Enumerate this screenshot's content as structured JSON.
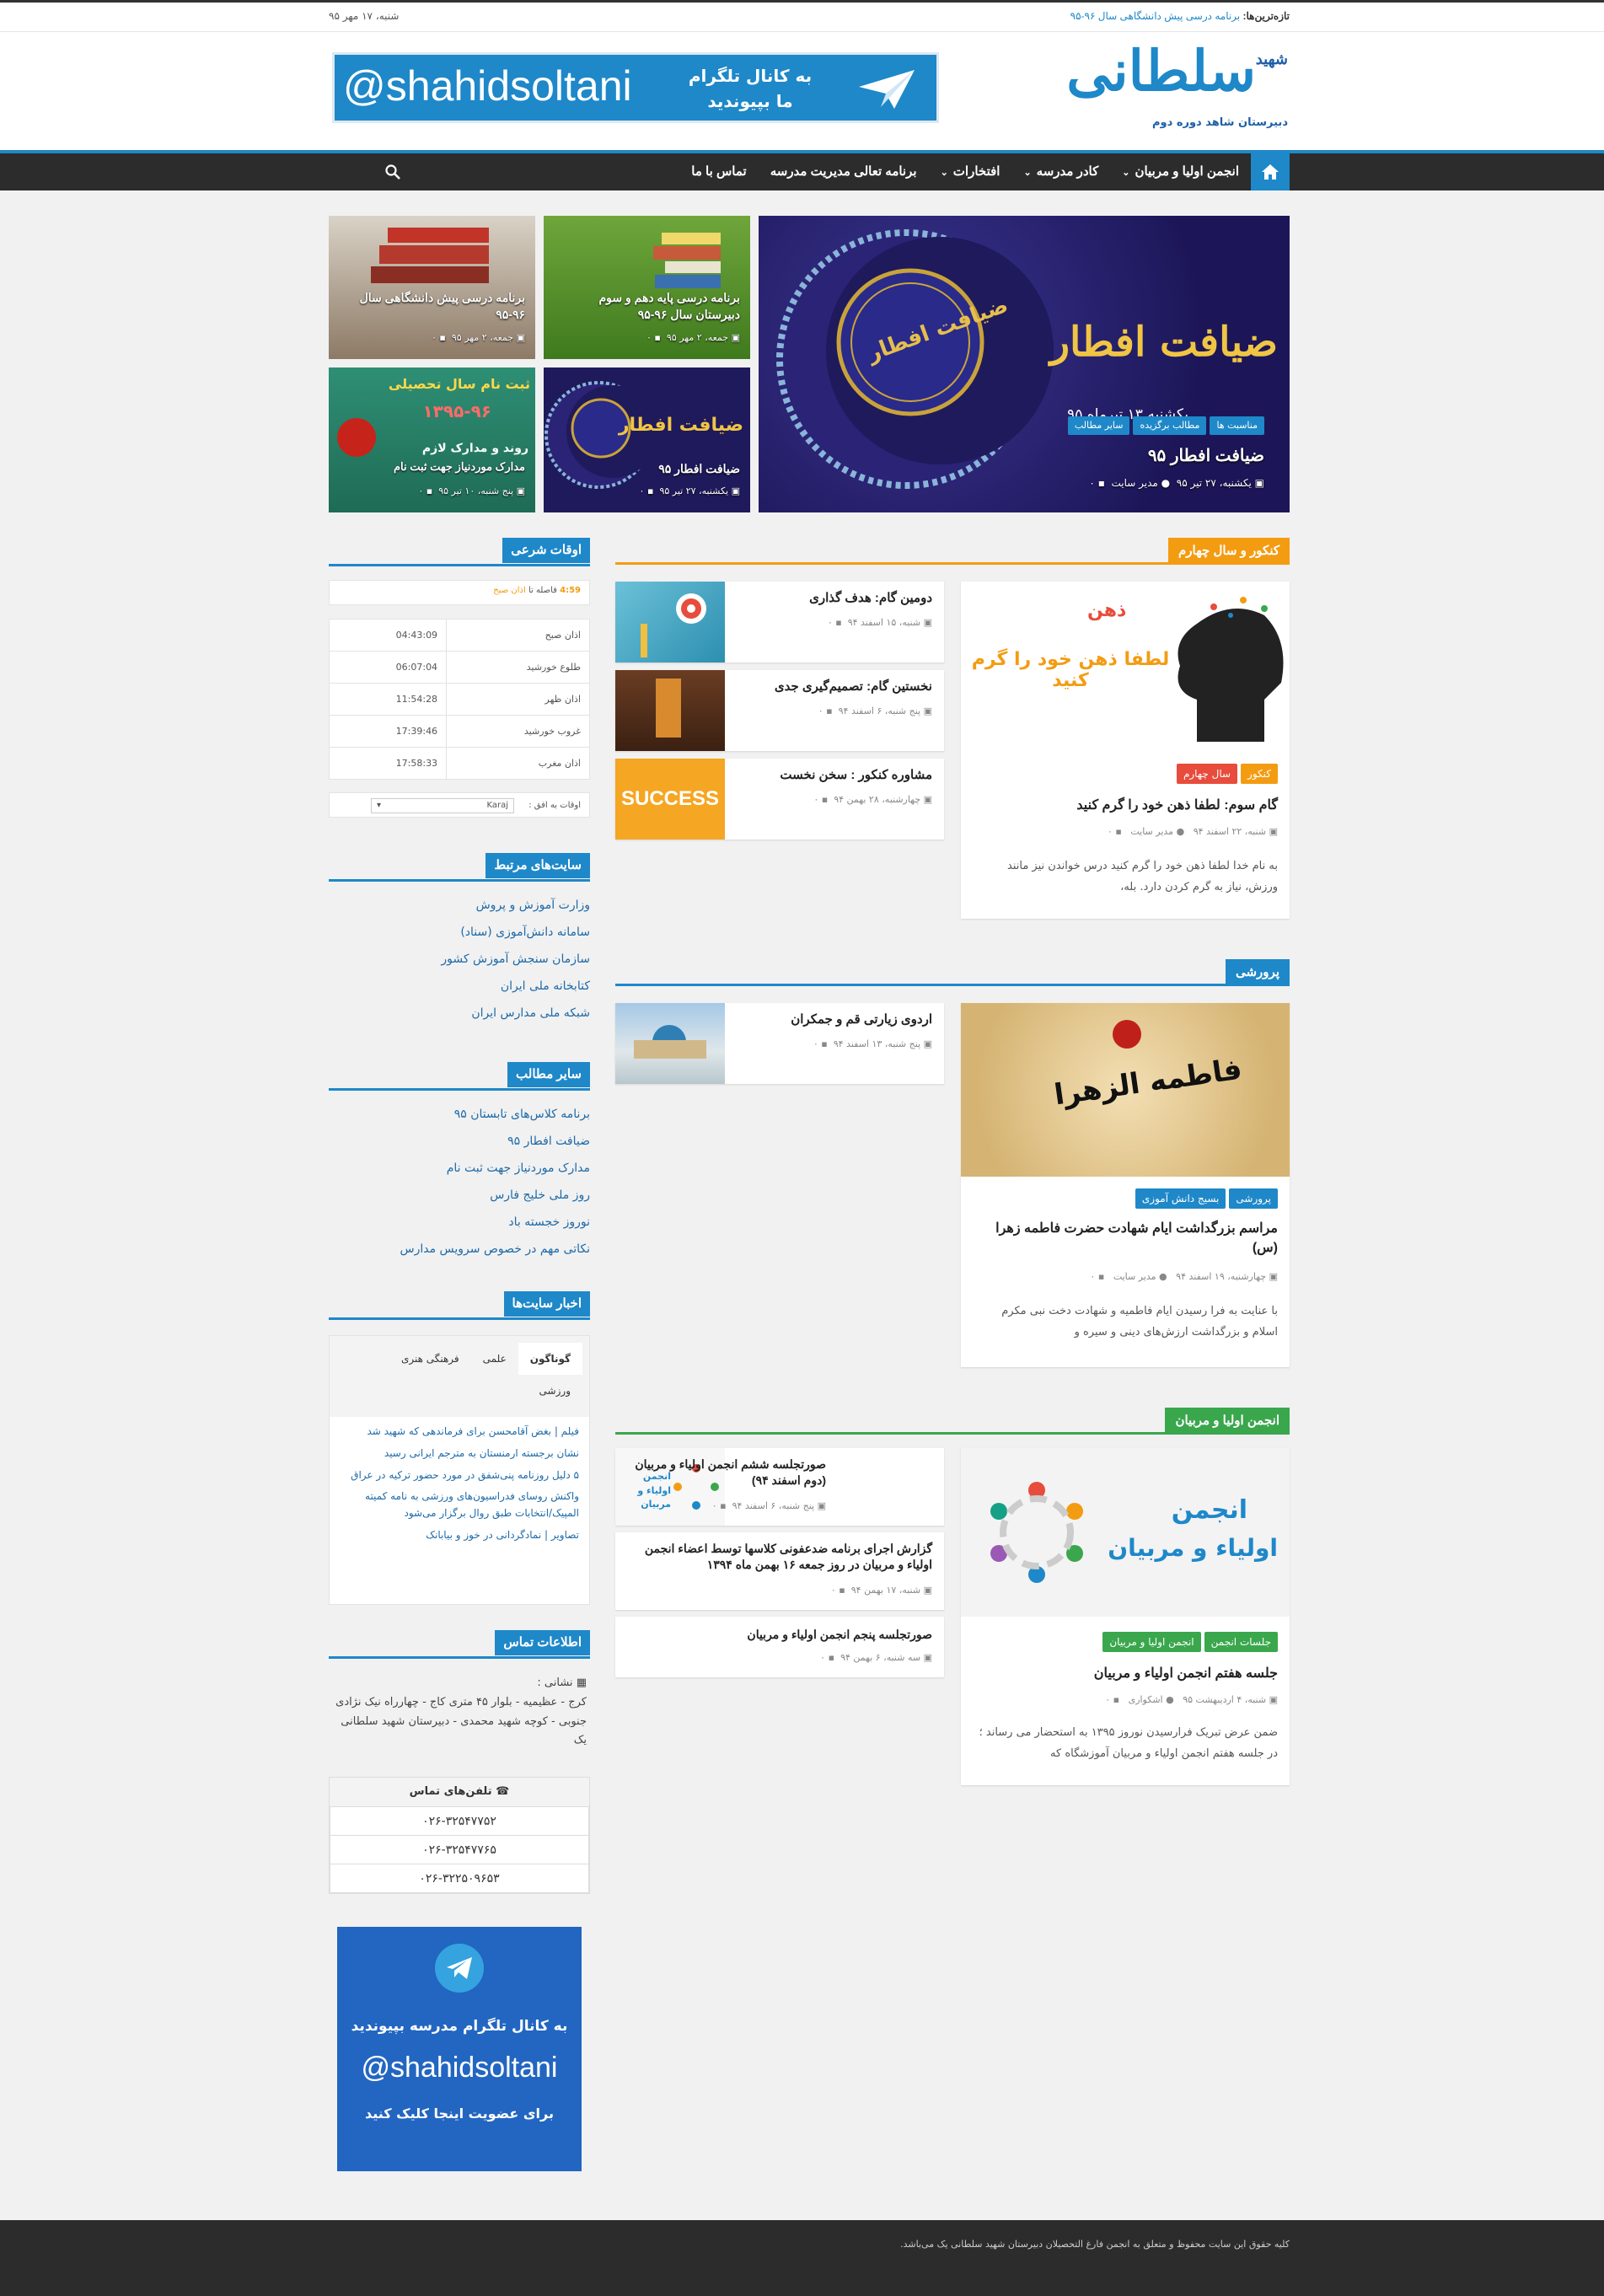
{
  "topbar": {
    "latest_label": "تازه‌ترین‌ها:",
    "latest_post": "برنامه درسی پیش دانشگاهی سال ۹۶-۹۵",
    "date": "شنبه، ۱۷ مهر ۹۵"
  },
  "header": {
    "logo_text": "سلطانی",
    "logo_small": "شهید",
    "logo_sub": "دبیرستان شاهد دوره دوم",
    "banner_handle": "@shahidsoltani",
    "banner_text": "به کانال تلگرام ما بپیوندید"
  },
  "nav": {
    "items": [
      {
        "label": "انجمن اولیا و مربیان",
        "has_sub": true
      },
      {
        "label": "کادر مدرسه",
        "has_sub": true
      },
      {
        "label": "افتخارات",
        "has_sub": true
      },
      {
        "label": "برنامه تعالی مدیریت مدرسه",
        "has_sub": false
      },
      {
        "label": "تماس با ما",
        "has_sub": false
      }
    ]
  },
  "slider": {
    "big": {
      "title": "ضیافت افطار ۹۵",
      "date": "یکشنبه، ۲۷ تیر ۹۵",
      "author": "مدیر سایت",
      "comments": "۰",
      "image_text": "ضیافت افطار",
      "image_overlay_date": "یکشنبه ۱۳ تیرماه ۹۵",
      "tags": [
        "سایر مطالب",
        "مطالب برگزیده",
        "مناسبت ها"
      ]
    },
    "tiles": [
      {
        "title": "برنامه درسی پایه دهم و سوم دبیرستان سال ۹۶-۹۵",
        "date": "جمعه، ۲ مهر ۹۵",
        "comments": "۰"
      },
      {
        "title": "برنامه درسی پیش دانشگاهی سال ۹۶-۹۵",
        "date": "جمعه، ۲ مهر ۹۵",
        "comments": "۰"
      },
      {
        "title": "ضیافت افطار ۹۵",
        "date": "یکشنبه، ۲۷ تیر ۹۵",
        "comments": "۰",
        "image_text": "ضیافت افطار"
      },
      {
        "title": "مدارک موردنیاز جهت ثبت نام",
        "date": "پنج شنبه، ۱۰ تیر ۹۵",
        "comments": "۰",
        "image_text": "ثبت نام سال تحصیلی",
        "image_text2": "۱۳۹۵-۹۶",
        "image_text3": "روند و مدارک لازم"
      }
    ]
  },
  "sections": [
    {
      "label": "کنکور و سال چهارم",
      "color": "#f39c12",
      "main": {
        "title": "گام سوم: لطفا ذهن خود را گرم کنید",
        "date": "شنبه، ۲۲ اسفند ۹۴",
        "author": "مدیر سایت",
        "comments": "۰",
        "excerpt": "به نام خدا لطفا ذهن خود را گرم کنید درس خواندن نیز مانند ورزش، نیاز به گرم کردن دارد. بله،",
        "tags": [
          "سال چهارم",
          "کنکور"
        ],
        "image_text": "لطفا ذهن خود را گرم کنید",
        "image_word": "ذهن"
      },
      "side": [
        {
          "title": "دومین گام: هدف گذاری",
          "date": "شنبه، ۱۵ اسفند ۹۴",
          "comments": "۰"
        },
        {
          "title": "نخستین گام: تصمیم‌گیری جدی",
          "date": "پنج شنبه، ۶ اسفند ۹۴",
          "comments": "۰"
        },
        {
          "title": "مشاوره کنکور : سخن نخست",
          "date": "چهارشنبه، ۲۸ بهمن ۹۴",
          "comments": "۰",
          "image_text": "SUCCESS"
        }
      ]
    },
    {
      "label": "پرورشی",
      "color": "#1e88c9",
      "main": {
        "title": "مراسم بزرگداشت ایام شهادت حضرت فاطمه زهرا (س)",
        "date": "چهارشنبه، ۱۹ اسفند ۹۴",
        "author": "مدیر سایت",
        "comments": "۰",
        "excerpt": "با عنایت به فرا رسیدن ایام فاطمیه و شهادت دخت نبی مکرم اسلام و بزرگداشت ارزش‌های دینی و سیره و",
        "tags": [
          "بسیج دانش آموزی",
          "پرورشی"
        ],
        "image_text": "فاطمه الزهرا"
      },
      "side": [
        {
          "title": "اردوی زیارتی قم و جمکران",
          "date": "پنج شنبه، ۱۳ اسفند ۹۴",
          "comments": "۰"
        }
      ]
    },
    {
      "label": "انجمن اولیا و مربیان",
      "color": "#3aa74d",
      "main": {
        "title": "جلسه هفتم انجمن اولیاء و مربیان",
        "date": "شنبه، ۴ اردیبهشت ۹۵",
        "author": "اشکواری",
        "comments": "۰",
        "excerpt": "ضمن عرض تبریک فرارسیدن نوروز ۱۳۹۵ به استحضار می رساند ؛ در جلسه هفتم انجمن اولیاء و مربیان آموزشگاه که",
        "tags": [
          "انجمن اولیا و مربیان",
          "جلسات انجمن"
        ],
        "image_text": "انجمن",
        "image_text2": "اولیاء و مربیان"
      },
      "side": [
        {
          "title": "صورتجلسه ششم انجمن اولیاء و مربیان (دوم اسفند ۹۴)",
          "date": "پنج شنبه، ۶ اسفند ۹۴",
          "comments": "۰",
          "image_text": "انجمن اولیاء و مربیان"
        },
        {
          "title": "گزارش اجرای برنامه ضدعفونی کلاسها توسط اعضاء انجمن اولیاء و مربیان در روز جمعه ۱۶ بهمن ماه ۱۳۹۴",
          "date": "شنبه، ۱۷ بهمن ۹۴",
          "comments": "۰"
        },
        {
          "title": "صورتجلسه پنجم انجمن اولیاء و مربیان",
          "date": "سه شنبه، ۶ بهمن ۹۴",
          "comments": "۰"
        }
      ]
    }
  ],
  "sidebar": {
    "prayer": {
      "title": "اوقات شرعی",
      "countdown_time": "4:59",
      "countdown_label": "فاصله تا",
      "countdown_target": "اذان صبح",
      "rows": [
        {
          "name": "اذان صبح",
          "time": "04:43:09"
        },
        {
          "name": "طلوع خورشید",
          "time": "06:07:04"
        },
        {
          "name": "اذان ظهر",
          "time": "11:54:28"
        },
        {
          "name": "غروب خورشید",
          "time": "17:39:46"
        },
        {
          "name": "اذان مغرب",
          "time": "17:58:33"
        }
      ],
      "city_label": "اوقات به افق :",
      "city": "Karaj"
    },
    "related_sites": {
      "title": "سایت‌های مرتبط",
      "links": [
        "وزارت آموزش و پروش",
        "سامانه دانش‌آموزی (سناد)",
        "سازمان سنجش آموزش کشور",
        "کتابخانه ملی ایران",
        "شبکه ملی مدارس ایران"
      ]
    },
    "other_posts": {
      "title": "سایر مطالب",
      "links": [
        "برنامه کلاس‌های تابستان ۹۵",
        "ضیافت افطار ۹۵",
        "مدارک موردنیاز جهت ثبت نام",
        "روز ملی خلیج فارس",
        "نوروز خجسته باد",
        "نکاتی مهم در خصوص سرویس مدارس"
      ]
    },
    "news": {
      "title": "اخبار سایت‌ها",
      "tabs": [
        "گوناگون",
        "علمی",
        "فرهنگی هنری",
        "ورزشی"
      ],
      "items": [
        "فیلم | بغض آقامحسن برای فرماندهی که شهید شد",
        "نشان برجسته ارمنستان به مترجم ایرانی رسید",
        "۵ دلیل روزنامه پنی‌شفق در مورد حضور ترکیه در عراق",
        "واکنش روسای فدراسیون‌های ورزشی به نامه کمیته المپیک/انتخابات طبق روال برگزار می‌شود",
        "تصاویر | نمادگردانی در خوز و بیابانک"
      ]
    },
    "contact": {
      "title": "اطلاعات تماس",
      "address_label": "نشانی :",
      "address": "کرج - عظیمیه - بلوار ۴۵ متری کاج - چهارراه نیک نژادی جنوبی - کوچه شهید محمدی - دبیرستان شهید سلطانی یک",
      "phones_label": "تلفن‌های تماس",
      "phones": [
        "۰۲۶-۳۲۵۴۷۷۵۲",
        "۰۲۶-۳۲۵۴۷۷۶۵",
        "۰۲۶-۳۲۲۵۰۹۶۵۳"
      ]
    },
    "telegram_banner": {
      "line1": "به کانال تلگرام مدرسه بپیوندید",
      "handle": "@shahidsoltani",
      "line2": "برای عضویت اینجا کلیک کنید"
    }
  },
  "footer": {
    "text": "کلیه حقوق این سایت محفوظ و متعلق به انجمن فارغ التحصیلان دبیرستان شهید سلطانی یک می‌باشد."
  },
  "colors": {
    "accent": "#1e88c9",
    "nav_bg": "#2c2c2c",
    "orange": "#f39c12",
    "green": "#3aa74d",
    "red": "#e74c3c"
  }
}
